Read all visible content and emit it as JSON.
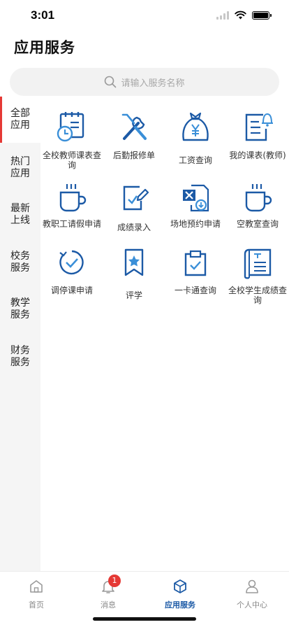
{
  "status_bar": {
    "time": "3:01"
  },
  "page": {
    "title": "应用服务"
  },
  "search": {
    "placeholder": "请输入服务名称",
    "icon": "search-icon"
  },
  "sidebar": {
    "items": [
      {
        "label": "全部应用",
        "active": true
      },
      {
        "label": "热门应用",
        "active": false
      },
      {
        "label": "最新上线",
        "active": false
      },
      {
        "label": "校务服务",
        "active": false
      },
      {
        "label": "教学服务",
        "active": false
      },
      {
        "label": "财务服务",
        "active": false
      }
    ]
  },
  "services": [
    {
      "label": "全校教师课表查询",
      "icon": "calendar-clock-icon"
    },
    {
      "label": "后勤报修单",
      "icon": "wrench-screwdriver-icon"
    },
    {
      "label": "工资查询",
      "icon": "money-bag-icon"
    },
    {
      "label": "我的课表(教师)",
      "icon": "schedule-bell-icon"
    },
    {
      "label": "教职工请假申请",
      "icon": "coffee-cup-icon"
    },
    {
      "label": "成绩录入",
      "icon": "edit-document-icon"
    },
    {
      "label": "场地预约申请",
      "icon": "excel-download-icon"
    },
    {
      "label": "空教室查询",
      "icon": "coffee-cup-icon"
    },
    {
      "label": "调停课申请",
      "icon": "check-cycle-icon"
    },
    {
      "label": "评学",
      "icon": "bookmark-star-icon"
    },
    {
      "label": "一卡通查询",
      "icon": "clipboard-check-icon"
    },
    {
      "label": "全校学生成绩查询",
      "icon": "report-book-icon"
    }
  ],
  "tabbar": {
    "items": [
      {
        "label": "首页",
        "icon": "home-icon",
        "active": false
      },
      {
        "label": "消息",
        "icon": "bell-icon",
        "active": false,
        "badge": "1"
      },
      {
        "label": "应用服务",
        "icon": "cube-icon",
        "active": true
      },
      {
        "label": "个人中心",
        "icon": "user-icon",
        "active": false
      }
    ]
  },
  "colors": {
    "accent": "#1c5aa6",
    "icon_blue": "#1c5aa6",
    "icon_light": "#3a8fd8",
    "sidebar_indicator": "#e53935",
    "badge": "#e53935"
  }
}
